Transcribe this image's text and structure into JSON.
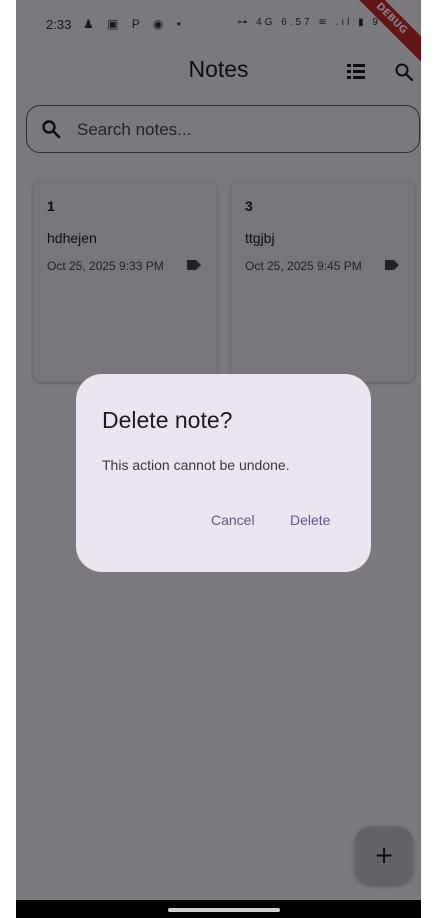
{
  "status_bar": {
    "time": "2:33",
    "left_icons": [
      "notification-icon",
      "linkedin-icon",
      "pinterest-icon",
      "app-icon",
      "dot-icon"
    ],
    "left_icons_text": "♟ ▣ P ◉ •",
    "right_text": "⊶ 4G 6.57 ≋ .ıl ▮ 9",
    "debug_label": "DEBUG"
  },
  "app_bar": {
    "title": "Notes",
    "list_view_icon": "view-list-icon",
    "search_icon": "search-icon"
  },
  "search": {
    "placeholder": "Search notes...",
    "value": ""
  },
  "notes": [
    {
      "title": "1",
      "body": "hdhejen",
      "date": "Oct 25, 2025 9:33 PM",
      "icon": "label-icon"
    },
    {
      "title": "3",
      "body": "ttgjbj",
      "date": "Oct 25, 2025 9:45 PM",
      "icon": "label-icon"
    }
  ],
  "dialog": {
    "title": "Delete note?",
    "message": "This action cannot be undone.",
    "cancel_label": "Cancel",
    "delete_label": "Delete"
  },
  "fab": {
    "label": "+"
  },
  "colors": {
    "background": "#f6f2fa",
    "card": "#f3edf7",
    "dialog": "#ebe5f1",
    "accent": "#65558f",
    "fab": "#c9c2d2",
    "debug": "#c62828"
  }
}
